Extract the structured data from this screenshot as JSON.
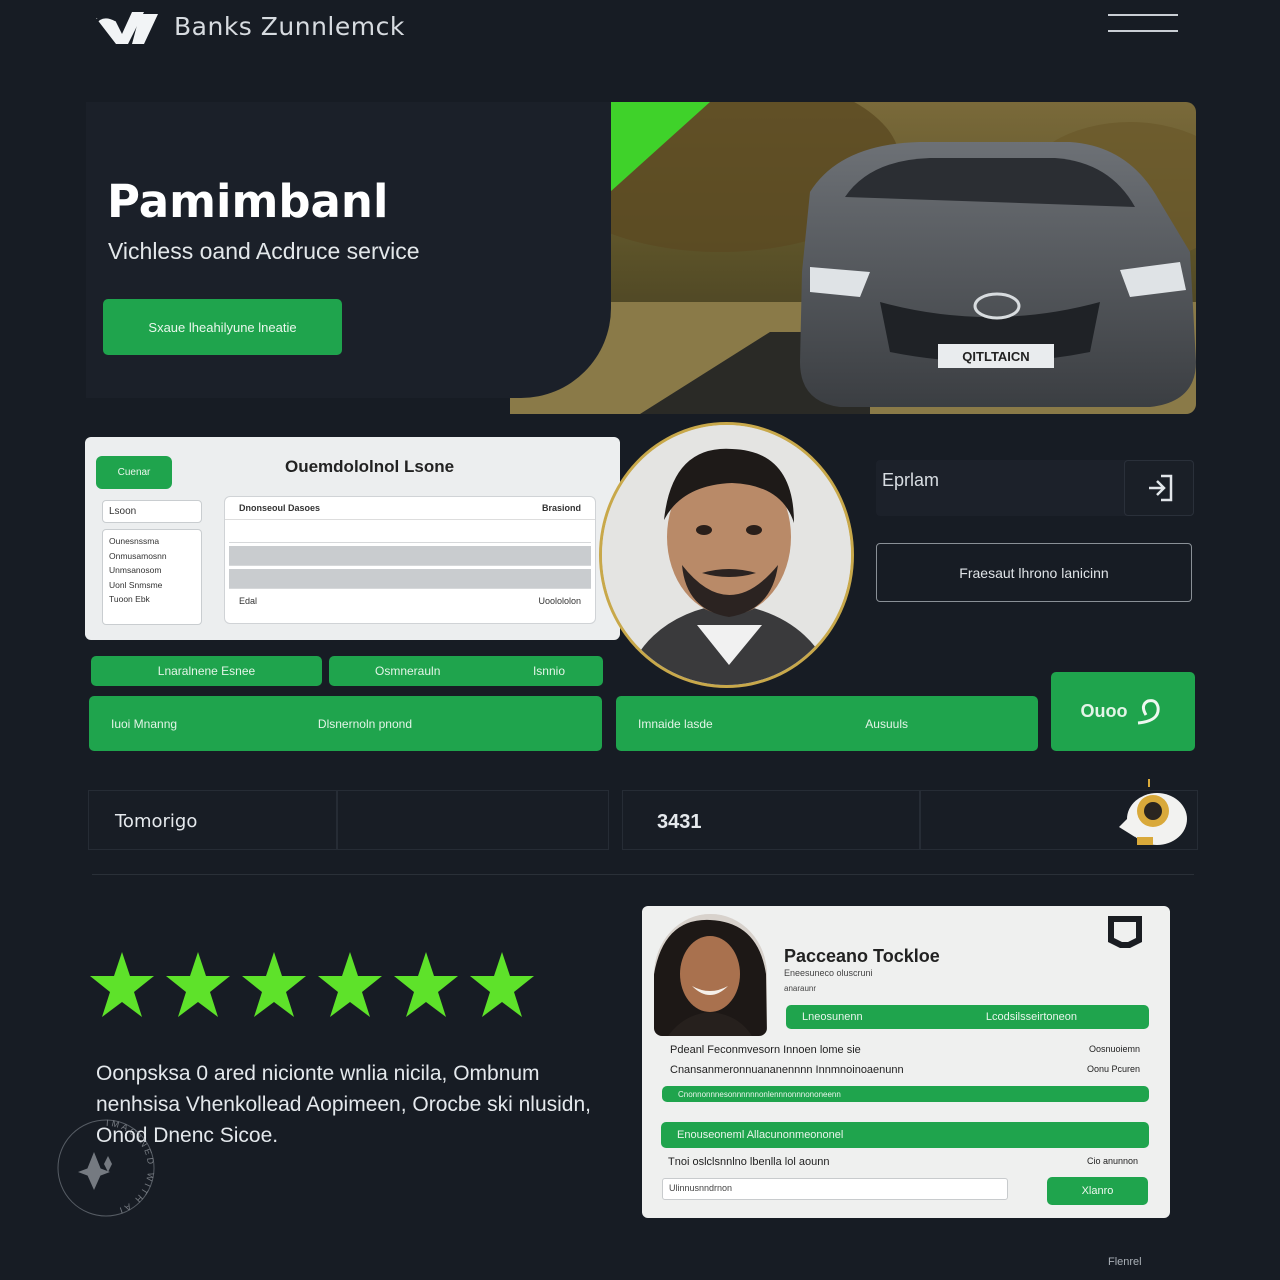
{
  "header": {
    "brand": "Banks Zunnlemck",
    "logo_icon": "brand-logo-mark",
    "menu_icon": "hamburger-menu-icon"
  },
  "hero": {
    "title": "Pamimbanl",
    "subtitle": "Vichless oand Acdruce service",
    "cta_label": "Sxaue lheahilyune lneatie"
  },
  "dashboard": {
    "tab_label": "Cuenar",
    "title": "Ouemdololnol Lsone",
    "side_header": "Lsoon",
    "side_items": [
      "Ounesnssma",
      "Onmusamosnn",
      "Unmsanosom",
      "Uonl Snmsme",
      "Tuoon Ebk"
    ],
    "table_headers": [
      "Dnonseoul Dasoes",
      "Brasiond"
    ],
    "table_footer": [
      "Edal",
      "Uoolololon"
    ]
  },
  "right_panel": {
    "field_label": "Eprlam",
    "field_icon": "login-arrow-icon",
    "outline_button": "Fraesaut lhrono lanicinn"
  },
  "green_bars": {
    "small_a": "Lnaralnene Esnee",
    "small_b_left": "Osmnerauln",
    "small_b_right": "Isnnio",
    "wide_a_left": "Iuoi Mnanng",
    "wide_a_right": "Dlsnernoln pnond",
    "wide_b_left": "Imnaide lasde",
    "wide_b_right": "Ausuuls",
    "key_button": "Ouoo"
  },
  "stats": {
    "label": "Tomorigo",
    "value": "3431",
    "mascot_icon": "astronaut-mascot-icon"
  },
  "review": {
    "rating": 6,
    "rating_max": 6,
    "text": "Oonpsksa 0 ared nicionte wnlia nicila, Ombnum nenhsisa Vhenkollead Aopimeen, Orocbe ski nlusidn, Onod Dnenc Sicoe."
  },
  "testimonial": {
    "name": "Pacceano Tockloe",
    "sub1": "Eneesuneco oluscruni",
    "sub2": "anaraunr",
    "badge_icon": "badge-corner-icon",
    "bar1_left": "Lneosunenn",
    "bar1_right": "Lcodsilsseirtoneon",
    "line1_left": "Pdeanl Feconmvesorn Innoen lome sie",
    "line1_right": "Oosnuoiemn",
    "line2_left": "Cnansanmeronnuananennnn Innmnoinoaenunn",
    "line2_right": "Oonu Pcuren",
    "bar2_text": "Cnonnonnnesonnnnnnonlennnonnnononeenn",
    "bar3_text": "Enouseoneml Allacunonmeononel",
    "line3_left": "Tnoi oslclsnnlno lbenlla lol aounn",
    "line3_right": "Cio anunnon",
    "input_value": "Ulinnusnndrnon",
    "button_label": "Xlanro"
  },
  "watermark": "IMAGINED WITH AI",
  "footer_note": "Flenrel",
  "colors": {
    "background": "#171c24",
    "accent_green": "#1fa44d",
    "star_green": "#5ee22a",
    "gold_ring": "#c8a84a"
  }
}
